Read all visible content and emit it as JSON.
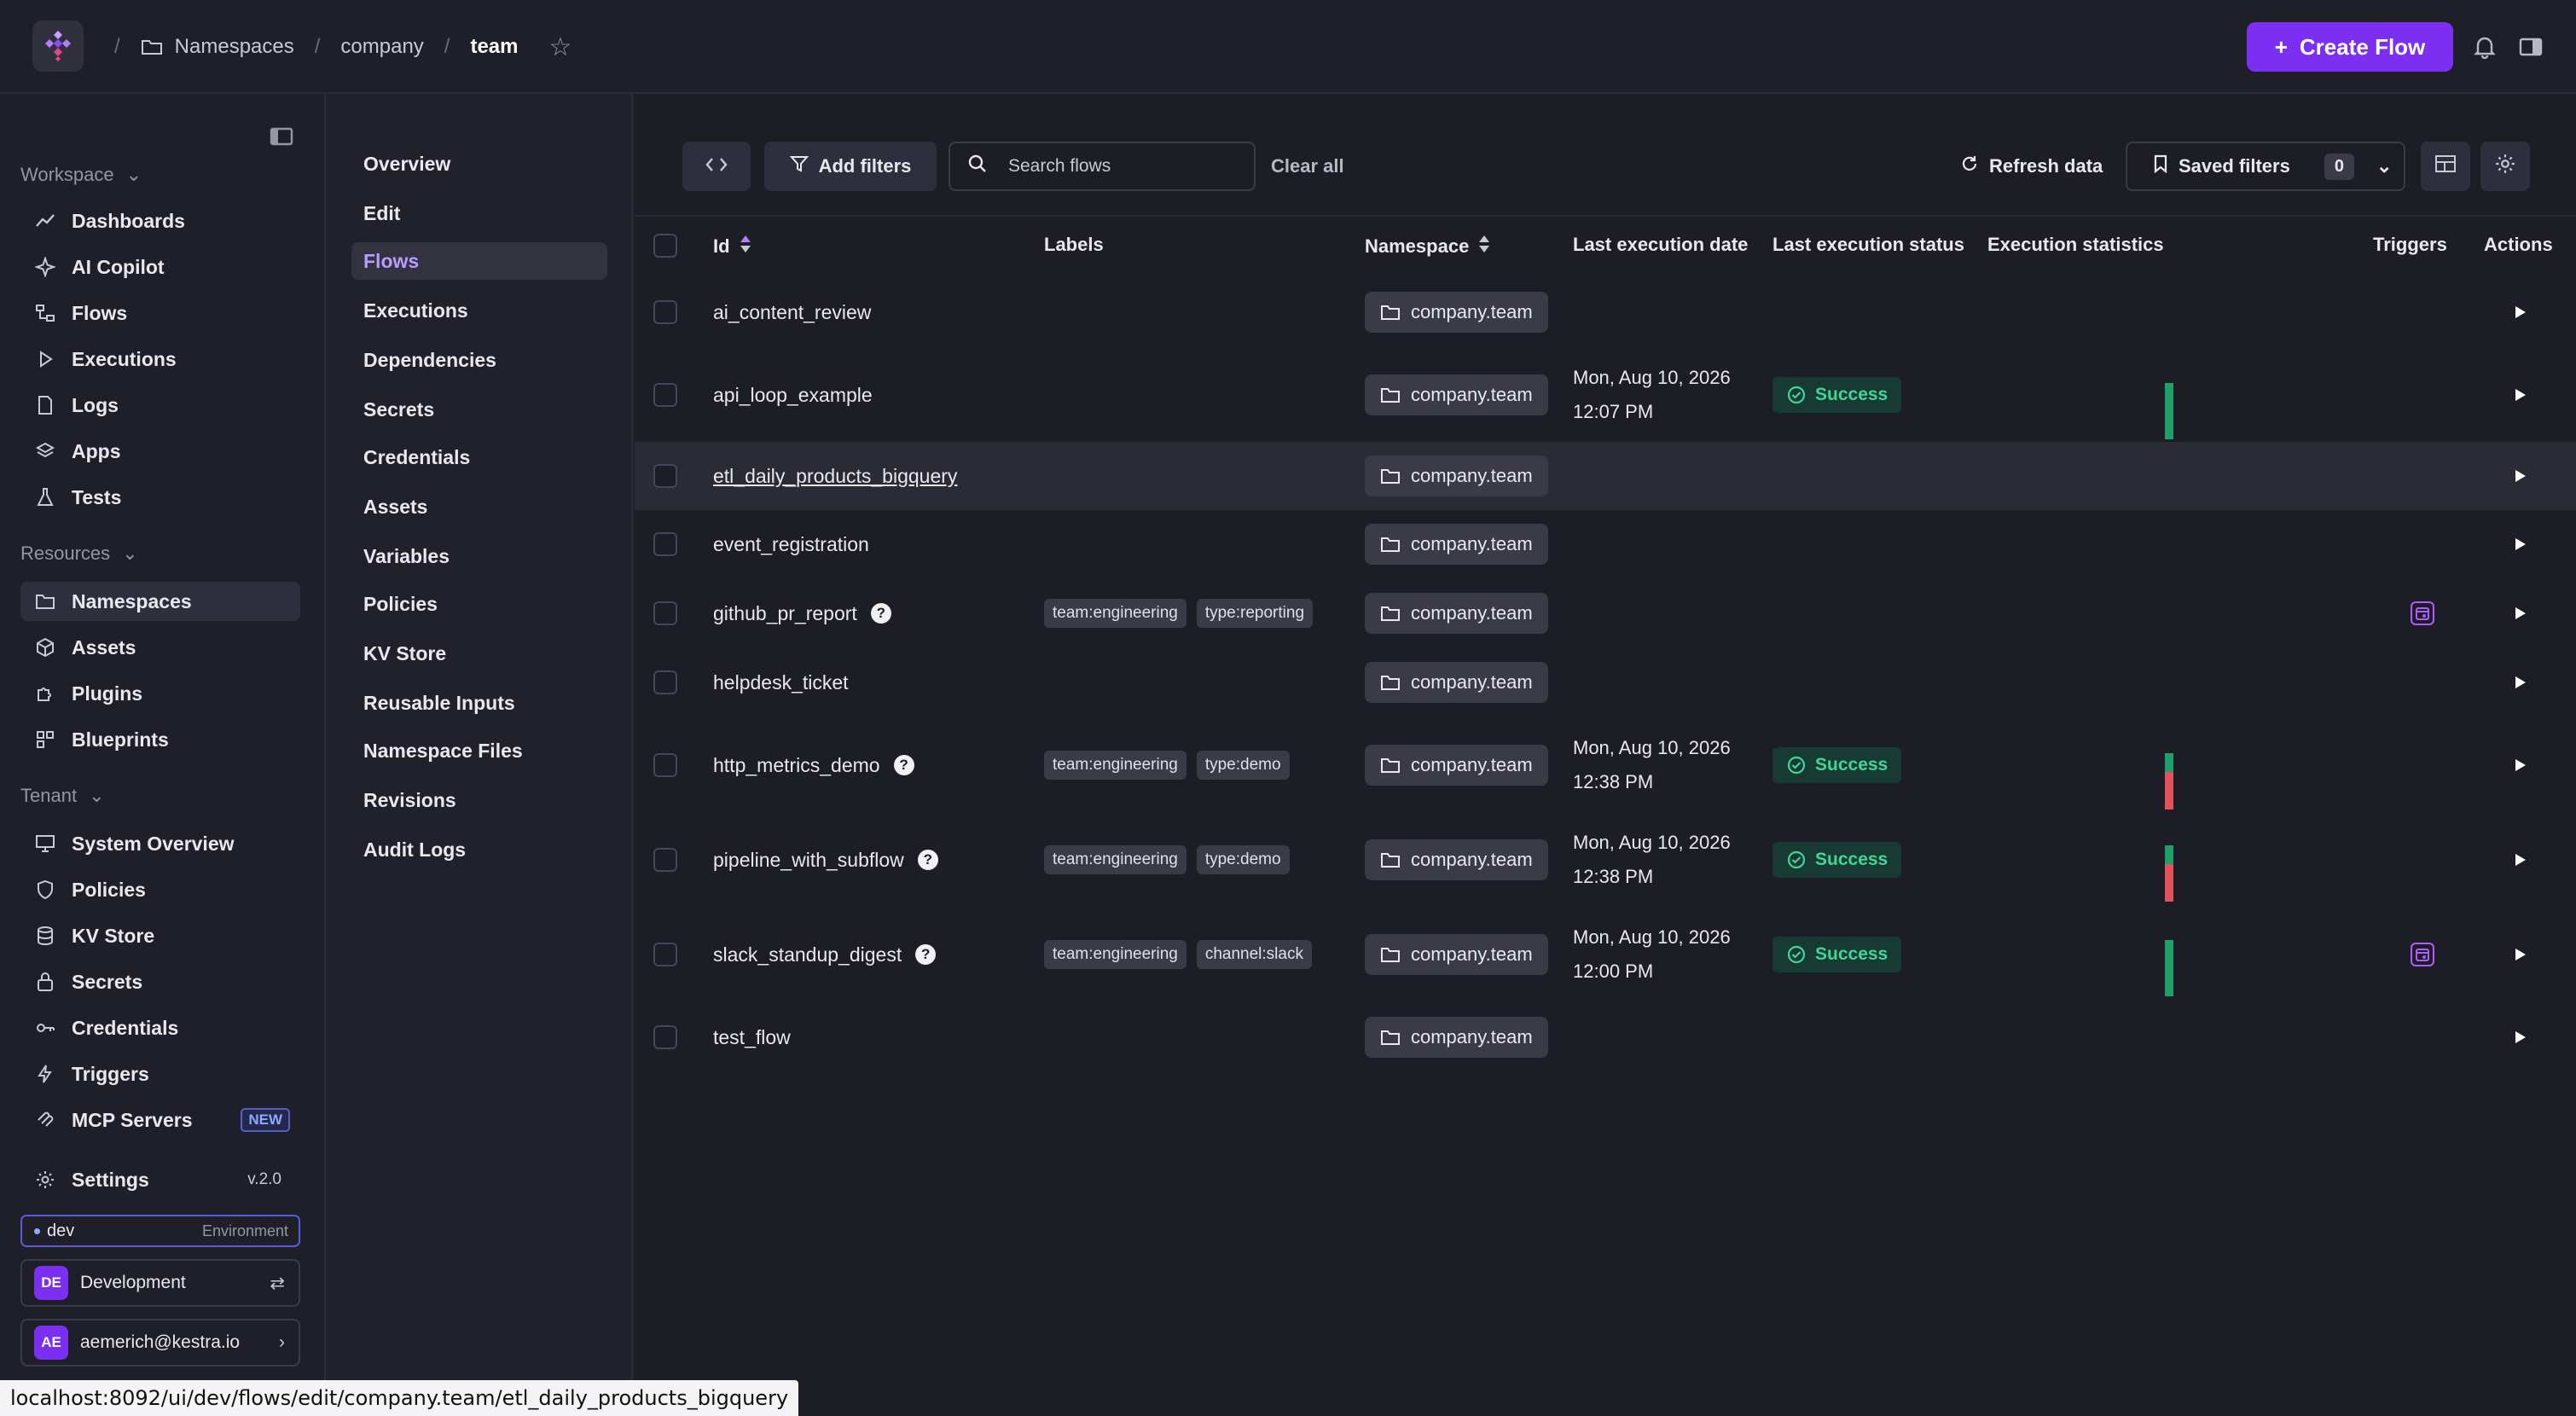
{
  "breadcrumb": {
    "items": [
      {
        "label": "Namespaces"
      },
      {
        "label": "company"
      },
      {
        "label": "team"
      }
    ]
  },
  "header": {
    "create_label": "Create Flow",
    "accent": "#7b2ff0"
  },
  "sidebar": {
    "sections": {
      "workspace": "Workspace",
      "resources": "Resources",
      "tenant": "Tenant"
    },
    "workspace_items": [
      {
        "label": "Dashboards",
        "icon": "chart-line-icon"
      },
      {
        "label": "AI Copilot",
        "icon": "sparkle-icon"
      },
      {
        "label": "Flows",
        "icon": "flow-icon"
      },
      {
        "label": "Executions",
        "icon": "play-outline-icon"
      },
      {
        "label": "Logs",
        "icon": "file-icon"
      },
      {
        "label": "Apps",
        "icon": "layers-icon"
      },
      {
        "label": "Tests",
        "icon": "flask-icon"
      }
    ],
    "resource_items": [
      {
        "label": "Namespaces",
        "icon": "folder-icon"
      },
      {
        "label": "Assets",
        "icon": "box-icon"
      },
      {
        "label": "Plugins",
        "icon": "puzzle-icon"
      },
      {
        "label": "Blueprints",
        "icon": "blueprint-icon"
      }
    ],
    "tenant_items": [
      {
        "label": "System Overview",
        "icon": "monitor-icon"
      },
      {
        "label": "Policies",
        "icon": "shield-icon"
      },
      {
        "label": "KV Store",
        "icon": "database-icon"
      },
      {
        "label": "Secrets",
        "icon": "lock-icon"
      },
      {
        "label": "Credentials",
        "icon": "key-icon"
      },
      {
        "label": "Triggers",
        "icon": "bolt-icon"
      },
      {
        "label": "MCP Servers",
        "icon": "mcp-icon",
        "badge": "NEW"
      }
    ],
    "settings": {
      "label": "Settings",
      "version": "v.2.0"
    },
    "environment": {
      "name": "dev",
      "label": "Environment"
    },
    "tenant_switch": {
      "initials": "DE",
      "name": "Development"
    },
    "user": {
      "initials": "AE",
      "email": "aemerich@kestra.io"
    }
  },
  "subnav": {
    "items": [
      {
        "label": "Overview"
      },
      {
        "label": "Edit"
      },
      {
        "label": "Flows"
      },
      {
        "label": "Executions"
      },
      {
        "label": "Dependencies"
      },
      {
        "label": "Secrets"
      },
      {
        "label": "Credentials"
      },
      {
        "label": "Assets"
      },
      {
        "label": "Variables"
      },
      {
        "label": "Policies"
      },
      {
        "label": "KV Store"
      },
      {
        "label": "Reusable Inputs"
      },
      {
        "label": "Namespace Files"
      },
      {
        "label": "Revisions"
      },
      {
        "label": "Audit Logs"
      }
    ],
    "active": "Flows"
  },
  "toolbar": {
    "add_filters": "Add filters",
    "search_placeholder": "Search flows",
    "clear_all": "Clear all",
    "refresh": "Refresh data",
    "saved_filters": "Saved filters",
    "saved_count": "0"
  },
  "table": {
    "columns": {
      "id": "Id",
      "labels": "Labels",
      "namespace": "Namespace",
      "last_date": "Last execution date",
      "last_status": "Last execution status",
      "stats": "Execution statistics",
      "triggers": "Triggers",
      "actions": "Actions"
    },
    "rows": [
      {
        "id": "ai_content_review",
        "namespace": "company.team",
        "labels": [],
        "date": "",
        "time": "",
        "status": "",
        "help": false,
        "trigger": false
      },
      {
        "id": "api_loop_example",
        "namespace": "company.team",
        "labels": [],
        "date": "Mon, Aug 10, 2026",
        "time": "12:07 PM",
        "status": "Success",
        "help": false,
        "trigger": false
      },
      {
        "id": "etl_daily_products_bigquery",
        "namespace": "company.team",
        "labels": [],
        "date": "",
        "time": "",
        "status": "",
        "help": false,
        "trigger": false
      },
      {
        "id": "event_registration",
        "namespace": "company.team",
        "labels": [],
        "date": "",
        "time": "",
        "status": "",
        "help": false,
        "trigger": false
      },
      {
        "id": "github_pr_report",
        "namespace": "company.team",
        "labels": [
          "team:engineering",
          "type:reporting"
        ],
        "date": "",
        "time": "",
        "status": "",
        "help": true,
        "trigger": true
      },
      {
        "id": "helpdesk_ticket",
        "namespace": "company.team",
        "labels": [],
        "date": "",
        "time": "",
        "status": "",
        "help": false,
        "trigger": false
      },
      {
        "id": "http_metrics_demo",
        "namespace": "company.team",
        "labels": [
          "team:engineering",
          "type:demo"
        ],
        "date": "Mon, Aug 10, 2026",
        "time": "12:38 PM",
        "status": "Success",
        "help": true,
        "trigger": false
      },
      {
        "id": "pipeline_with_subflow",
        "namespace": "company.team",
        "labels": [
          "team:engineering",
          "type:demo"
        ],
        "date": "Mon, Aug 10, 2026",
        "time": "12:38 PM",
        "status": "Success",
        "help": true,
        "trigger": false
      },
      {
        "id": "slack_standup_digest",
        "namespace": "company.team",
        "labels": [
          "team:engineering",
          "channel:slack"
        ],
        "date": "Mon, Aug 10, 2026",
        "time": "12:00 PM",
        "status": "Success",
        "help": true,
        "trigger": true
      },
      {
        "id": "test_flow",
        "namespace": "company.team",
        "labels": [],
        "date": "",
        "time": "",
        "status": "",
        "help": false,
        "trigger": false
      }
    ],
    "stats_colors": {
      "success": "#1fa06b",
      "failed": "#e0525c"
    }
  },
  "statusbar": {
    "url": "localhost:8092/ui/dev/flows/edit/company.team/etl_daily_products_bigquery"
  }
}
